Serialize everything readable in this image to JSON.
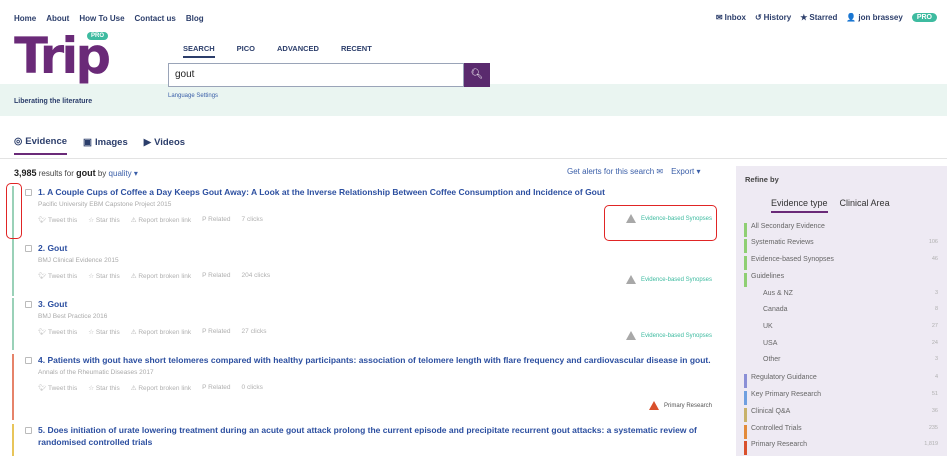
{
  "topnav": [
    "Home",
    "About",
    "How To Use",
    "Contact us",
    "Blog"
  ],
  "usernav": {
    "inbox": "Inbox",
    "history": "History",
    "starred": "Starred",
    "user": "jon brassey",
    "pro": "PRO"
  },
  "logo": {
    "text": "Trip",
    "pro": "PRO",
    "tagline": "Liberating the literature"
  },
  "search": {
    "tabs": [
      "SEARCH",
      "PICO",
      "ADVANCED",
      "RECENT"
    ],
    "value": "gout",
    "language": "Language Settings"
  },
  "tabs": [
    "Evidence",
    "Images",
    "Videos"
  ],
  "results_header": {
    "count": "3,985",
    "middle": "results for",
    "term": "gout",
    "by": "by",
    "sort": "quality ▾",
    "alerts": "Get alerts for this search",
    "export": "Export ▾"
  },
  "action_labels": {
    "tweet": "Tweet this",
    "star": "Star this",
    "report": "Report broken link",
    "related": "Related"
  },
  "results": [
    {
      "title": "1. A Couple Cups of Coffee a Day Keeps Gout Away: A Look at the Inverse Relationship Between Coffee Consumption and Incidence of Gout",
      "meta": "Pacific University EBM Capstone Project   2015",
      "clicks": "7 clicks",
      "type": "Evidence-based Synopses"
    },
    {
      "title": "2. Gout",
      "meta": "BMJ Clinical Evidence   2015",
      "clicks": "204 clicks",
      "type": "Evidence-based Synopses"
    },
    {
      "title": "3. Gout",
      "meta": "BMJ Best Practice   2016",
      "clicks": "27 clicks",
      "type": "Evidence-based Synopses"
    },
    {
      "title": "4. Patients with gout have short telomeres compared with healthy participants: association of telomere length with flare frequency and cardiovascular disease in gout.",
      "meta": "Annals of the Rheumatic Diseases   2017",
      "clicks": "0 clicks",
      "type": "Primary Research"
    },
    {
      "title": "5. Does initiation of urate lowering treatment during an acute gout attack prolong the current episode and precipitate recurrent gout attacks: a systematic review of randomised controlled trials"
    }
  ],
  "refine": {
    "title": "Refine by",
    "tabs": [
      "Evidence type",
      "Clinical Area"
    ],
    "facets": [
      {
        "label": "All Secondary Evidence",
        "count": "",
        "color": "#8fcf73"
      },
      {
        "label": "Systematic Reviews",
        "count": "106",
        "color": "#8fcf73"
      },
      {
        "label": "Evidence-based Synopses",
        "count": "46",
        "color": "#8fcf73"
      },
      {
        "label": "Guidelines",
        "count": "",
        "color": "#8fcf73"
      },
      {
        "label": "Aus & NZ",
        "count": "3",
        "color": "",
        "sub": true
      },
      {
        "label": "Canada",
        "count": "8",
        "color": "",
        "sub": true
      },
      {
        "label": "UK",
        "count": "27",
        "color": "",
        "sub": true
      },
      {
        "label": "USA",
        "count": "24",
        "color": "",
        "sub": true
      },
      {
        "label": "Other",
        "count": "3",
        "color": "",
        "sub": true
      },
      {
        "label": "Regulatory Guidance",
        "count": "4",
        "color": "#8a8fd6"
      },
      {
        "label": "Key Primary Research",
        "count": "51",
        "color": "#6f9fe0"
      },
      {
        "label": "Clinical Q&A",
        "count": "36",
        "color": "#c8b26a"
      },
      {
        "label": "Controlled Trials",
        "count": "235",
        "color": "#e38a3a"
      },
      {
        "label": "Primary Research",
        "count": "1,819",
        "color": "#d9502c"
      }
    ]
  },
  "colors": {
    "brand": "#6a2a78",
    "link": "#2c4fa0",
    "accent": "#3ebba0",
    "annotation": "#e02525"
  }
}
